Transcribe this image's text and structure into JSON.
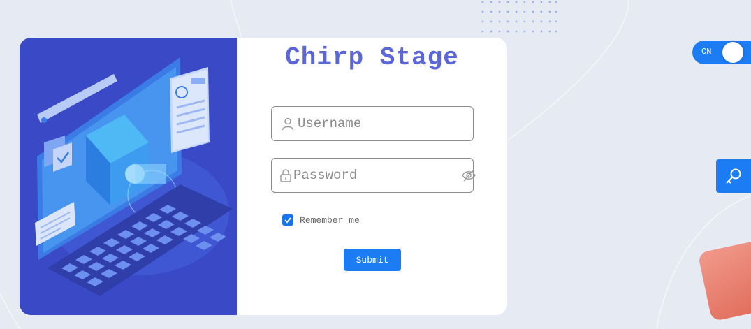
{
  "app": {
    "title": "Chirp Stage"
  },
  "login": {
    "username_placeholder": "Username",
    "password_placeholder": "Password",
    "remember_label": "Remember me",
    "remember_checked": true,
    "submit_label": "Submit"
  },
  "language_toggle": {
    "label": "CN"
  },
  "icons": {
    "username": "user-icon",
    "password": "lock-icon",
    "visibility": "eye-off-icon",
    "side_button": "key-search-icon",
    "checkbox": "checkmark-icon"
  },
  "colors": {
    "background": "#e6eaf2",
    "title": "#5b67d6",
    "accent": "#1c7cf4",
    "illustration": "#3a49c6",
    "decoration": "#e06a58"
  }
}
